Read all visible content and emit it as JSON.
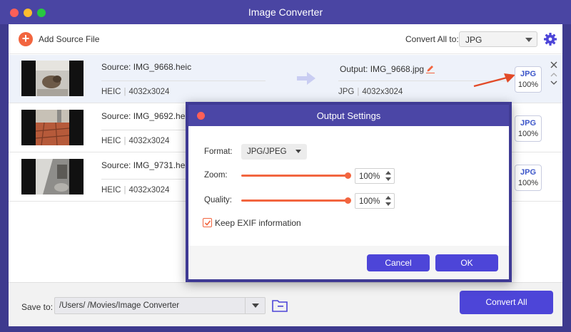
{
  "app": {
    "title": "Image Converter"
  },
  "toolbar": {
    "add_source": "Add Source File",
    "convert_all_label": "Convert All to:",
    "convert_all_format": "JPG"
  },
  "files": [
    {
      "source": "Source: IMG_9668.heic",
      "src_format": "HEIC",
      "src_res": "4032x3024",
      "output": "Output: IMG_9668.jpg",
      "out_format": "JPG",
      "out_res": "4032x3024",
      "badge_format": "JPG",
      "badge_quality": "100%"
    },
    {
      "source": "Source: IMG_9692.heic",
      "src_format": "HEIC",
      "src_res": "4032x3024",
      "badge_format": "JPG",
      "badge_quality": "100%"
    },
    {
      "source": "Source: IMG_9731.heic",
      "src_format": "HEIC",
      "src_res": "4032x3024",
      "badge_format": "JPG",
      "badge_quality": "100%"
    }
  ],
  "bottom": {
    "save_to_label": "Save to:",
    "path": "/Users/        /Movies/Image Converter",
    "convert_all_button": "Convert All"
  },
  "modal": {
    "title": "Output Settings",
    "format_label": "Format:",
    "format_value": "JPG/JPEG",
    "zoom_label": "Zoom:",
    "zoom_value": "100%",
    "quality_label": "Quality:",
    "quality_value": "100%",
    "keep_exif": "Keep EXIF information",
    "keep_exif_checked": true,
    "cancel": "Cancel",
    "ok": "OK"
  },
  "colors": {
    "accent": "#4d45d8",
    "orange": "#f2653f",
    "titlebar": "#4a45a3"
  }
}
